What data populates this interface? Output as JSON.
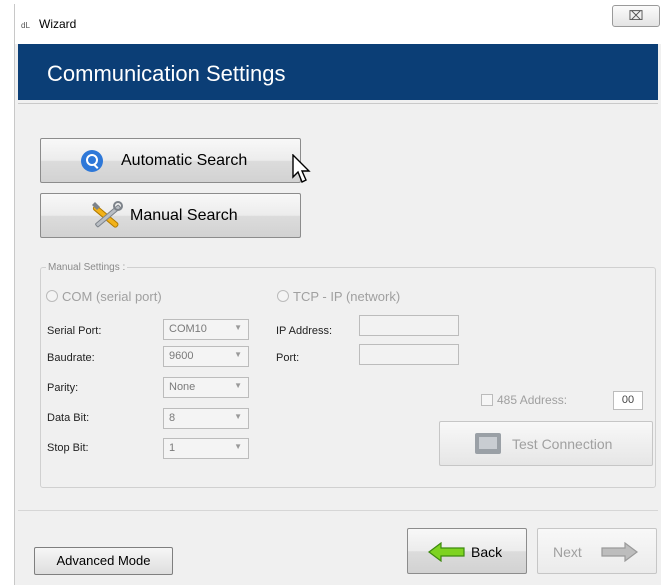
{
  "window": {
    "app_icon_text": "dL",
    "title": "Wizard",
    "close_glyph": "⌧"
  },
  "header": {
    "title": "Communication Settings",
    "bg_color": "#0b3e76"
  },
  "search_buttons": {
    "automatic": "Automatic Search",
    "manual": "Manual Search"
  },
  "manual_settings": {
    "legend": "Manual Settings :",
    "com_radio": "COM (serial port)",
    "tcp_radio": "TCP - IP (network)",
    "serial_port": {
      "label": "Serial Port:",
      "value": "COM10"
    },
    "baudrate": {
      "label": "Baudrate:",
      "value": "9600"
    },
    "parity": {
      "label": "Parity:",
      "value": "None"
    },
    "data_bit": {
      "label": "Data Bit:",
      "value": "8"
    },
    "stop_bit": {
      "label": "Stop Bit:",
      "value": "1"
    },
    "ip_address": {
      "label": "IP Address:",
      "value": ""
    },
    "port": {
      "label": "Port:",
      "value": ""
    },
    "address_485": {
      "label": "485 Address:",
      "value": "00",
      "checked": false
    },
    "test_connection": "Test Connection"
  },
  "footer": {
    "advanced_mode": "Advanced Mode",
    "back": "Back",
    "next": "Next"
  }
}
